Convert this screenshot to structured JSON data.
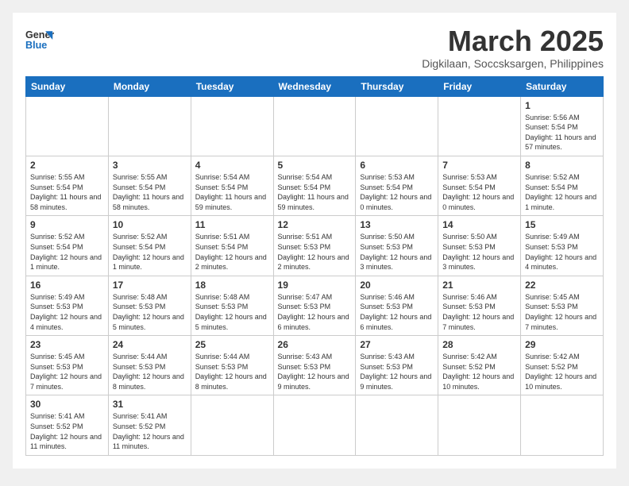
{
  "logo": {
    "line1": "General",
    "line2": "Blue"
  },
  "title": "March 2025",
  "subtitle": "Digkilaan, Soccsksargen, Philippines",
  "weekdays": [
    "Sunday",
    "Monday",
    "Tuesday",
    "Wednesday",
    "Thursday",
    "Friday",
    "Saturday"
  ],
  "days": {
    "1": {
      "sunrise": "5:56 AM",
      "sunset": "5:54 PM",
      "daylight": "11 hours and 57 minutes."
    },
    "2": {
      "sunrise": "5:55 AM",
      "sunset": "5:54 PM",
      "daylight": "11 hours and 58 minutes."
    },
    "3": {
      "sunrise": "5:55 AM",
      "sunset": "5:54 PM",
      "daylight": "11 hours and 58 minutes."
    },
    "4": {
      "sunrise": "5:54 AM",
      "sunset": "5:54 PM",
      "daylight": "11 hours and 59 minutes."
    },
    "5": {
      "sunrise": "5:54 AM",
      "sunset": "5:54 PM",
      "daylight": "11 hours and 59 minutes."
    },
    "6": {
      "sunrise": "5:53 AM",
      "sunset": "5:54 PM",
      "daylight": "12 hours and 0 minutes."
    },
    "7": {
      "sunrise": "5:53 AM",
      "sunset": "5:54 PM",
      "daylight": "12 hours and 0 minutes."
    },
    "8": {
      "sunrise": "5:52 AM",
      "sunset": "5:54 PM",
      "daylight": "12 hours and 1 minute."
    },
    "9": {
      "sunrise": "5:52 AM",
      "sunset": "5:54 PM",
      "daylight": "12 hours and 1 minute."
    },
    "10": {
      "sunrise": "5:52 AM",
      "sunset": "5:54 PM",
      "daylight": "12 hours and 1 minute."
    },
    "11": {
      "sunrise": "5:51 AM",
      "sunset": "5:54 PM",
      "daylight": "12 hours and 2 minutes."
    },
    "12": {
      "sunrise": "5:51 AM",
      "sunset": "5:53 PM",
      "daylight": "12 hours and 2 minutes."
    },
    "13": {
      "sunrise": "5:50 AM",
      "sunset": "5:53 PM",
      "daylight": "12 hours and 3 minutes."
    },
    "14": {
      "sunrise": "5:50 AM",
      "sunset": "5:53 PM",
      "daylight": "12 hours and 3 minutes."
    },
    "15": {
      "sunrise": "5:49 AM",
      "sunset": "5:53 PM",
      "daylight": "12 hours and 4 minutes."
    },
    "16": {
      "sunrise": "5:49 AM",
      "sunset": "5:53 PM",
      "daylight": "12 hours and 4 minutes."
    },
    "17": {
      "sunrise": "5:48 AM",
      "sunset": "5:53 PM",
      "daylight": "12 hours and 5 minutes."
    },
    "18": {
      "sunrise": "5:48 AM",
      "sunset": "5:53 PM",
      "daylight": "12 hours and 5 minutes."
    },
    "19": {
      "sunrise": "5:47 AM",
      "sunset": "5:53 PM",
      "daylight": "12 hours and 6 minutes."
    },
    "20": {
      "sunrise": "5:46 AM",
      "sunset": "5:53 PM",
      "daylight": "12 hours and 6 minutes."
    },
    "21": {
      "sunrise": "5:46 AM",
      "sunset": "5:53 PM",
      "daylight": "12 hours and 7 minutes."
    },
    "22": {
      "sunrise": "5:45 AM",
      "sunset": "5:53 PM",
      "daylight": "12 hours and 7 minutes."
    },
    "23": {
      "sunrise": "5:45 AM",
      "sunset": "5:53 PM",
      "daylight": "12 hours and 7 minutes."
    },
    "24": {
      "sunrise": "5:44 AM",
      "sunset": "5:53 PM",
      "daylight": "12 hours and 8 minutes."
    },
    "25": {
      "sunrise": "5:44 AM",
      "sunset": "5:53 PM",
      "daylight": "12 hours and 8 minutes."
    },
    "26": {
      "sunrise": "5:43 AM",
      "sunset": "5:53 PM",
      "daylight": "12 hours and 9 minutes."
    },
    "27": {
      "sunrise": "5:43 AM",
      "sunset": "5:53 PM",
      "daylight": "12 hours and 9 minutes."
    },
    "28": {
      "sunrise": "5:42 AM",
      "sunset": "5:52 PM",
      "daylight": "12 hours and 10 minutes."
    },
    "29": {
      "sunrise": "5:42 AM",
      "sunset": "5:52 PM",
      "daylight": "12 hours and 10 minutes."
    },
    "30": {
      "sunrise": "5:41 AM",
      "sunset": "5:52 PM",
      "daylight": "12 hours and 11 minutes."
    },
    "31": {
      "sunrise": "5:41 AM",
      "sunset": "5:52 PM",
      "daylight": "12 hours and 11 minutes."
    }
  }
}
